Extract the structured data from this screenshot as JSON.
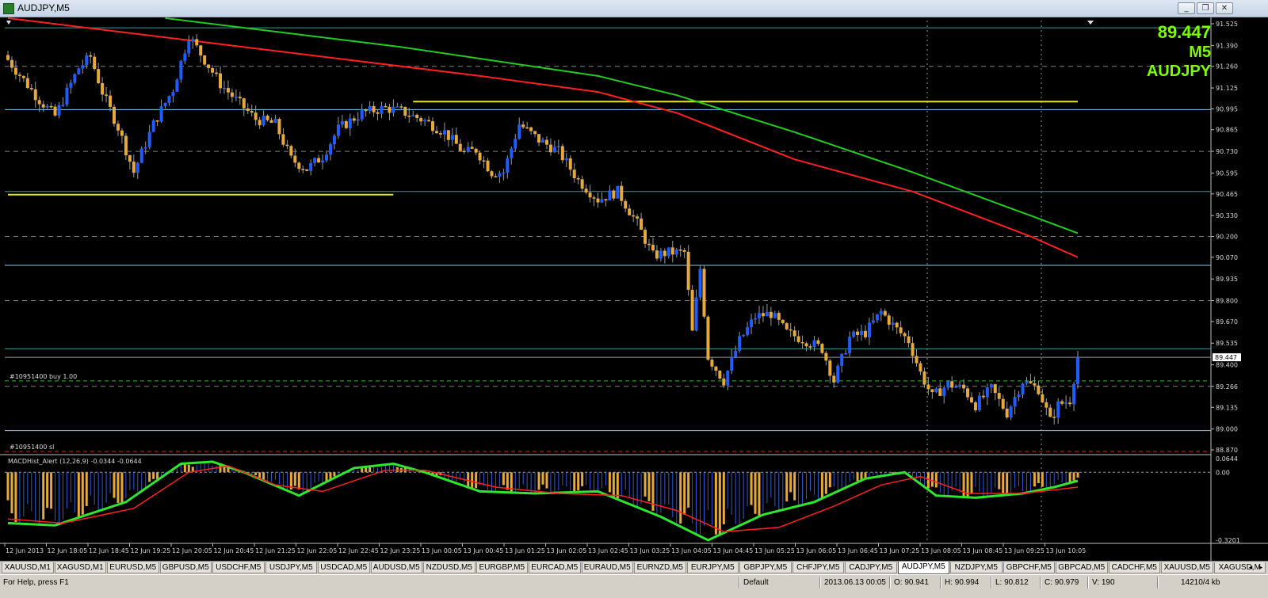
{
  "window": {
    "title": "AUDJPY,M5",
    "buttons": [
      "_",
      "❐",
      "✕"
    ]
  },
  "overlay": {
    "price": "89.447",
    "timeframe": "M5",
    "symbol": "AUDJPY"
  },
  "order_labels": {
    "buy": "#10951400 buy 1.00",
    "sl": "#10951400 sl"
  },
  "indicator": {
    "name": "MACDHist_Alert (12,26,9) -0.0344 -0.0644"
  },
  "colors": {
    "background": "#000000",
    "bull_candle": "#1f5cff",
    "bear_candle": "#e6a93a",
    "ma_fast": "#ff2020",
    "ma_slow": "#22cc22",
    "hline_blue": "#7fc8f0",
    "hline_yellow": "#e8e800",
    "hline_teal": "#3a9a9a",
    "macd_main": "#2ee62e",
    "macd_signal": "#ff2020",
    "current_price_tag": "#ffffff"
  },
  "chart_data": {
    "type": "candlestick",
    "symbol": "AUDJPY",
    "timeframe": "M5",
    "price_axis_ticks": [
      "91.525",
      "91.390",
      "91.260",
      "91.125",
      "90.995",
      "90.865",
      "90.730",
      "90.595",
      "90.465",
      "90.330",
      "90.200",
      "90.070",
      "89.935",
      "89.800",
      "89.670",
      "89.535",
      "89.400",
      "89.266",
      "89.135",
      "89.000",
      "88.870"
    ],
    "ylim": [
      88.87,
      91.525
    ],
    "current_price": 89.447,
    "current_price_label": "89.447",
    "time_axis_labels": [
      "12 Jun 2013",
      "12 Jun 18:05",
      "12 Jun 18:45",
      "12 Jun 19:25",
      "12 Jun 20:05",
      "12 Jun 20:45",
      "12 Jun 21:25",
      "12 Jun 22:05",
      "12 Jun 22:45",
      "12 Jun 23:25",
      "13 Jun 00:05",
      "13 Jun 00:45",
      "13 Jun 01:25",
      "13 Jun 02:05",
      "13 Jun 02:45",
      "13 Jun 03:25",
      "13 Jun 04:05",
      "13 Jun 04:45",
      "13 Jun 05:25",
      "13 Jun 06:05",
      "13 Jun 06:45",
      "13 Jun 07:25",
      "13 Jun 08:05",
      "13 Jun 08:45",
      "13 Jun 09:25",
      "13 Jun 10:05"
    ],
    "candle_count": 198,
    "close_anchors": [
      [
        0,
        91.3
      ],
      [
        8,
        91.05
      ],
      [
        12,
        90.95
      ],
      [
        18,
        91.25
      ],
      [
        21,
        91.32
      ],
      [
        24,
        91.1
      ],
      [
        28,
        90.88
      ],
      [
        32,
        90.6
      ],
      [
        37,
        90.9
      ],
      [
        42,
        91.12
      ],
      [
        46,
        91.45
      ],
      [
        50,
        91.3
      ],
      [
        54,
        91.15
      ],
      [
        58,
        91.05
      ],
      [
        63,
        90.93
      ],
      [
        68,
        90.9
      ],
      [
        72,
        90.68
      ],
      [
        76,
        90.62
      ],
      [
        80,
        90.7
      ],
      [
        84,
        90.87
      ],
      [
        90,
        90.97
      ],
      [
        96,
        91.0
      ],
      [
        100,
        90.98
      ],
      [
        106,
        90.92
      ],
      [
        111,
        90.85
      ],
      [
        116,
        90.72
      ],
      [
        119,
        90.74
      ],
      [
        123,
        90.6
      ],
      [
        126,
        90.6
      ],
      [
        130,
        90.9
      ],
      [
        135,
        90.8
      ],
      [
        140,
        90.73
      ],
      [
        145,
        90.55
      ],
      [
        150,
        90.43
      ],
      [
        155,
        90.48
      ],
      [
        160,
        90.28
      ],
      [
        164,
        90.08
      ],
      [
        168,
        90.1
      ],
      [
        172,
        90.1
      ],
      [
        174,
        89.6
      ],
      [
        176,
        90.0
      ],
      [
        178,
        89.45
      ],
      [
        182,
        89.3
      ],
      [
        186,
        89.55
      ],
      [
        190,
        89.7
      ],
      [
        194,
        89.72
      ],
      [
        198,
        89.6
      ],
      [
        203,
        89.55
      ],
      [
        207,
        89.5
      ],
      [
        210,
        89.3
      ],
      [
        214,
        89.57
      ],
      [
        218,
        89.6
      ],
      [
        222,
        89.73
      ],
      [
        226,
        89.62
      ],
      [
        229,
        89.55
      ],
      [
        232,
        89.35
      ],
      [
        235,
        89.2
      ],
      [
        239,
        89.28
      ],
      [
        243,
        89.25
      ],
      [
        246,
        89.15
      ],
      [
        250,
        89.25
      ],
      [
        254,
        89.1
      ],
      [
        258,
        89.3
      ],
      [
        262,
        89.25
      ],
      [
        265,
        89.05
      ],
      [
        267,
        89.15
      ],
      [
        270,
        89.18
      ],
      [
        272,
        89.447
      ]
    ],
    "ma_fast": [
      [
        0,
        91.56
      ],
      [
        60,
        91.38
      ],
      [
        120,
        91.2
      ],
      [
        150,
        91.1
      ],
      [
        170,
        90.97
      ],
      [
        200,
        90.68
      ],
      [
        230,
        90.48
      ],
      [
        260,
        90.2
      ],
      [
        272,
        90.07
      ]
    ],
    "ma_slow": [
      [
        40,
        91.56
      ],
      [
        100,
        91.38
      ],
      [
        150,
        91.2
      ],
      [
        170,
        91.08
      ],
      [
        200,
        90.85
      ],
      [
        230,
        90.6
      ],
      [
        260,
        90.33
      ],
      [
        272,
        90.22
      ]
    ],
    "horizontal_lines": [
      {
        "price": 91.5,
        "style": "teal"
      },
      {
        "price": 90.99,
        "style": "blue"
      },
      {
        "price": 90.48,
        "style": "teal"
      },
      {
        "price": 90.02,
        "style": "blue"
      },
      {
        "price": 89.5,
        "style": "teal"
      },
      {
        "price": 88.99,
        "style": "blue"
      },
      {
        "price": 89.3,
        "style": "green_dash"
      },
      {
        "price": 88.86,
        "style": "red_dash"
      }
    ],
    "dashed_grid_prices": [
      91.26,
      90.73,
      90.2,
      89.8,
      89.266
    ],
    "yellow_segments": [
      {
        "from": 0,
        "to": 98,
        "price": 90.46
      },
      {
        "from": 103,
        "to": 272,
        "price": 91.04
      }
    ],
    "macd_axis_ticks": [
      "0.0644",
      "0.00",
      "-0.3201"
    ],
    "macd_ylim": [
      -0.3201,
      0.0644
    ],
    "macd_main": [
      [
        0,
        -0.24
      ],
      [
        12,
        -0.25
      ],
      [
        30,
        -0.14
      ],
      [
        44,
        0.04
      ],
      [
        52,
        0.05
      ],
      [
        60,
        0.0
      ],
      [
        74,
        -0.11
      ],
      [
        88,
        0.02
      ],
      [
        98,
        0.04
      ],
      [
        106,
        0.0
      ],
      [
        120,
        -0.09
      ],
      [
        134,
        -0.1
      ],
      [
        150,
        -0.09
      ],
      [
        166,
        -0.21
      ],
      [
        178,
        -0.32
      ],
      [
        192,
        -0.2
      ],
      [
        205,
        -0.14
      ],
      [
        218,
        -0.03
      ],
      [
        228,
        0.0
      ],
      [
        236,
        -0.11
      ],
      [
        246,
        -0.12
      ],
      [
        258,
        -0.1
      ],
      [
        266,
        -0.07
      ],
      [
        272,
        -0.04
      ]
    ],
    "macd_signal": [
      [
        0,
        -0.22
      ],
      [
        14,
        -0.24
      ],
      [
        32,
        -0.17
      ],
      [
        46,
        0.0
      ],
      [
        56,
        0.03
      ],
      [
        68,
        -0.06
      ],
      [
        80,
        -0.09
      ],
      [
        96,
        0.01
      ],
      [
        106,
        0.01
      ],
      [
        124,
        -0.07
      ],
      [
        140,
        -0.1
      ],
      [
        156,
        -0.11
      ],
      [
        170,
        -0.18
      ],
      [
        182,
        -0.28
      ],
      [
        196,
        -0.26
      ],
      [
        210,
        -0.16
      ],
      [
        222,
        -0.06
      ],
      [
        232,
        -0.02
      ],
      [
        244,
        -0.1
      ],
      [
        258,
        -0.1
      ],
      [
        272,
        -0.07
      ]
    ]
  },
  "tabs": {
    "items": [
      "XAUUSD,M1",
      "XAGUSD,M1",
      "EURUSD,M5",
      "GBPUSD,M5",
      "USDCHF,M5",
      "USDJPY,M5",
      "USDCAD,M5",
      "AUDUSD,M5",
      "NZDUSD,M5",
      "EURGBP,M5",
      "EURCAD,M5",
      "EURAUD,M5",
      "EURNZD,M5",
      "EURJPY,M5",
      "GBPJPY,M5",
      "CHFJPY,M5",
      "CADJPY,M5",
      "AUDJPY,M5",
      "NZDJPY,M5",
      "GBPCHF,M5",
      "GBPCAD,M5",
      "CADCHF,M5",
      "XAUUSD,M5",
      "XAGUSD,M"
    ],
    "active_index": 17
  },
  "status": {
    "help": "For Help, press F1",
    "profile": "Default",
    "datetime": "2013.06.13 00:05",
    "open": "O: 90.941",
    "high": "H: 90.994",
    "low": "L: 90.812",
    "close": "C: 90.979",
    "volume": "V: 190",
    "traffic": "14210/4 kb"
  }
}
